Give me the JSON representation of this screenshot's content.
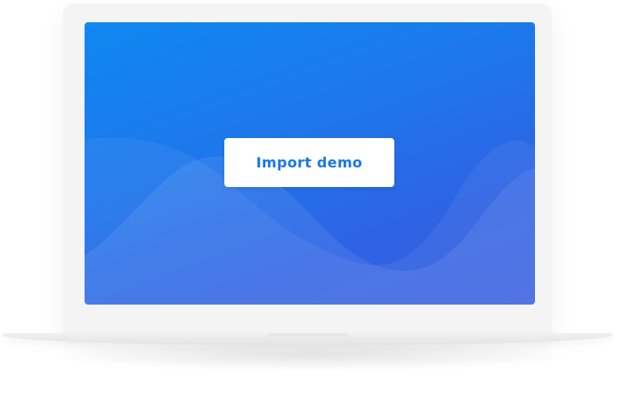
{
  "device": {
    "type": "laptop-mockup",
    "frame_color": "#f4f4f5",
    "screen_gradient": [
      "#0f88f0",
      "#2e63e4"
    ]
  },
  "screen": {
    "button": {
      "label": "Import demo",
      "text_color": "#1b78e6",
      "background": "#ffffff"
    }
  }
}
